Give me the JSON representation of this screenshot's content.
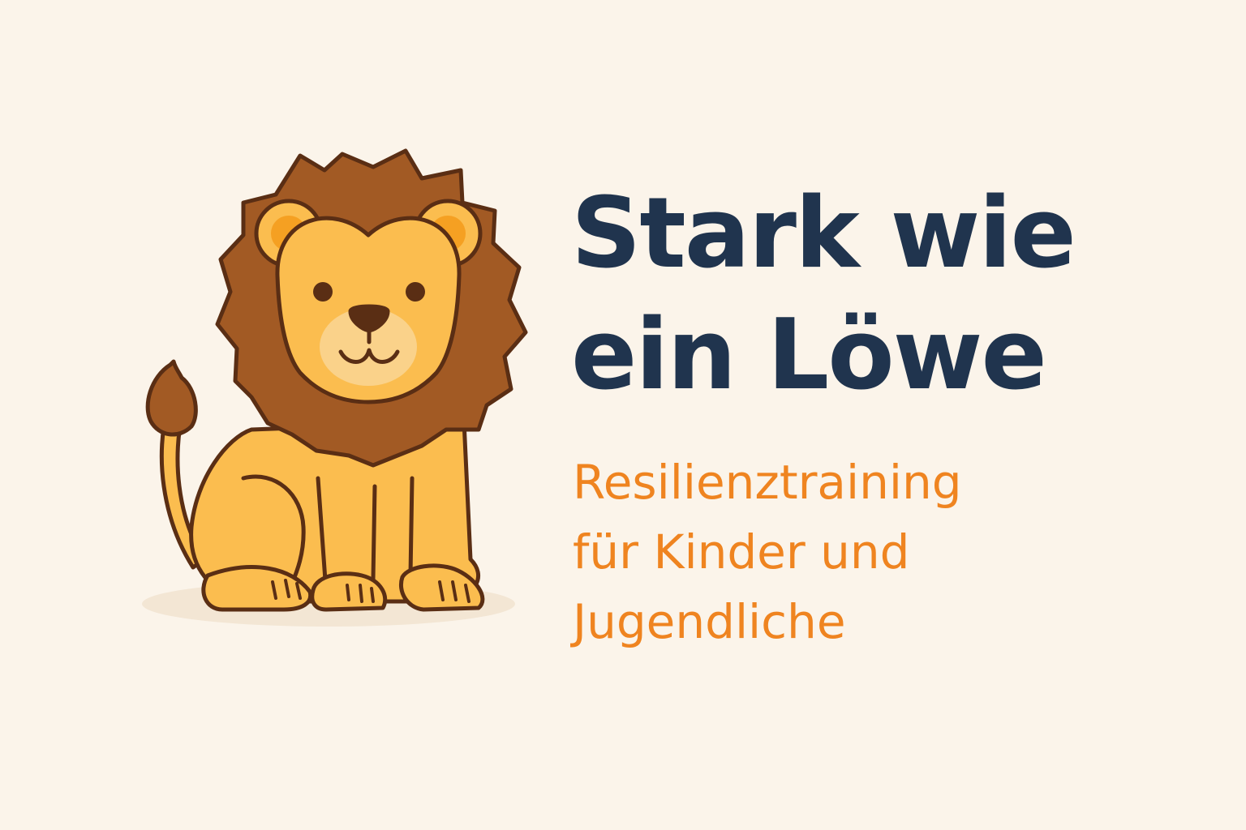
{
  "headline": {
    "line1": "Stark wie",
    "line2": "ein Löwe"
  },
  "subline": {
    "line1": "Resilienztraining",
    "line2": "für Kinder und",
    "line3": "Jugendliche"
  },
  "illustration": {
    "icon": "lion-icon"
  },
  "colors": {
    "background": "#fbf4ea",
    "headline": "#20344e",
    "subline": "#ef8420",
    "mane": "#a25a24",
    "fur": "#fbbd4f",
    "outline": "#5a2e14"
  }
}
